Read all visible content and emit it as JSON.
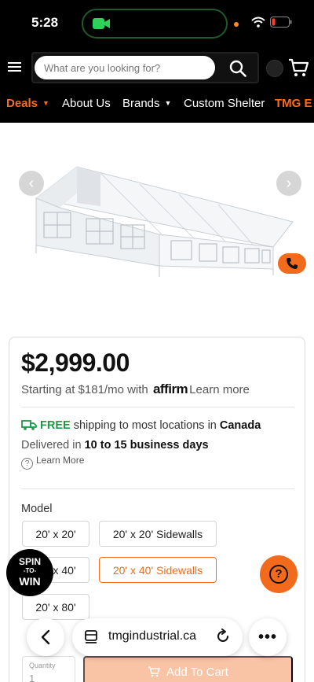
{
  "status": {
    "time": "5:28"
  },
  "header": {
    "search_placeholder": "What are you looking for?"
  },
  "nav": {
    "items": [
      {
        "label": "Deals",
        "caret": "▼"
      },
      {
        "label": "About Us",
        "caret": ""
      },
      {
        "label": "Brands",
        "caret": "▼"
      },
      {
        "label": "Custom Shelter",
        "caret": ""
      },
      {
        "label": "TMG E",
        "caret": ""
      }
    ]
  },
  "product": {
    "price": "$2,999.00",
    "financing_prefix": "Starting at $181/mo with",
    "financing_brand": "affirm",
    "financing_link": "Learn more",
    "shipping_free": "FREE",
    "shipping_text": "shipping to most locations in",
    "shipping_country": "Canada",
    "delivery_prefix": "Delivered in",
    "delivery_time": "10 to 15 business days",
    "help_link": "Learn More",
    "model_label": "Model",
    "model_options": [
      "20' x 20'",
      "20' x 20' Sidewalls",
      "20' x 40'",
      "20' x 40' Sidewalls",
      "20' x 80'"
    ],
    "selected_option": "20' x 40' Sidewalls",
    "quantity_label": "Quantity",
    "quantity_value": "1",
    "add_to_cart": "Add To Cart"
  },
  "promo": {
    "line1": "SPIN",
    "line2": "-TO-",
    "line3": "WIN"
  },
  "help_fab": "?",
  "browser": {
    "url": "tmgindustrial.ca"
  },
  "colors": {
    "accent": "#f26b1d",
    "free_green": "#1d9a45",
    "header_bg": "#000000"
  }
}
